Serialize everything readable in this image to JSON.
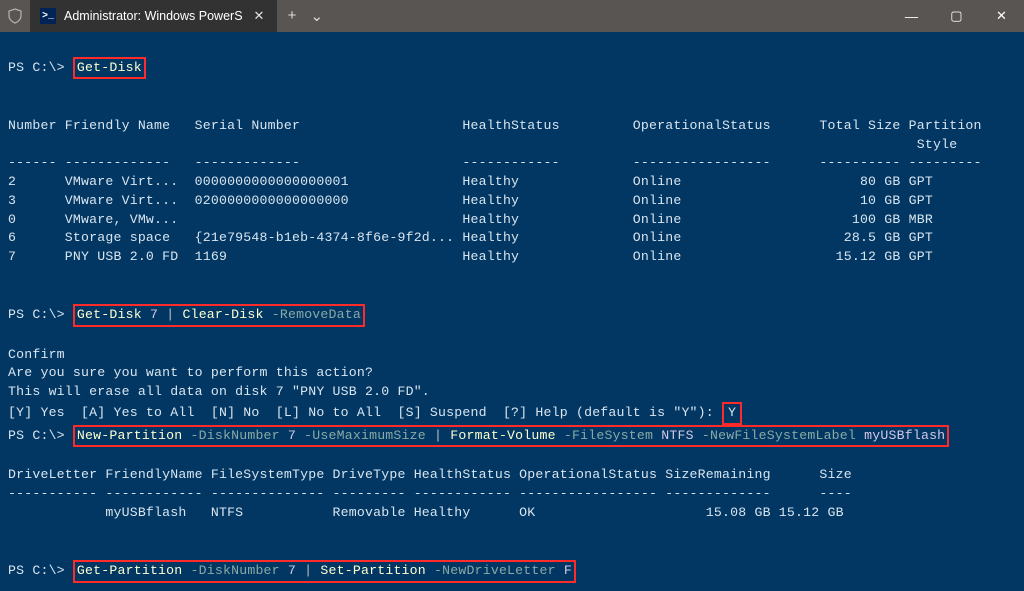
{
  "window": {
    "tab_title": "Administrator: Windows PowerS",
    "icon_glyph": ">_",
    "close_glyph": "✕",
    "new_tab_glyph": "+",
    "dropdown_glyph": "⌄",
    "min_glyph": "—",
    "max_glyph": "▢",
    "wclose_glyph": "✕"
  },
  "prompt": "PS C:\\>",
  "cmd1": "Get-Disk",
  "disk_header": "Number Friendly Name   Serial Number                    HealthStatus         OperationalStatus      Total Size Partition\n                                                                                                                Style",
  "disk_sep": "------ -------------   -------------                    ------------         -----------------      ---------- ---------",
  "disk_rows": [
    "2      VMware Virt...  0000000000000000001              Healthy              Online                      80 GB GPT",
    "3      VMware Virt...  0200000000000000000              Healthy              Online                      10 GB GPT",
    "0      VMware, VMw...                                   Healthy              Online                     100 GB MBR",
    "6      Storage space   {21e79548-b1eb-4374-8f6e-9f2d... Healthy              Online                    28.5 GB GPT",
    "7      PNY USB 2.0 FD  1169                             Healthy              Online                   15.12 GB GPT"
  ],
  "cmd2": {
    "a": "Get-Disk",
    "n": "7",
    "pipe": "|",
    "b": "Clear-Disk",
    "p": "-RemoveData"
  },
  "confirm_title": "Confirm",
  "confirm_l1": "Are you sure you want to perform this action?",
  "confirm_l2": "This will erase all data on disk 7 \"PNY USB 2.0 FD\".",
  "confirm_opts": "[Y] Yes  [A] Yes to All  [N] No  [L] No to All  [S] Suspend  [?] Help (default is \"Y\"):",
  "confirm_ans": "Y",
  "cmd3": {
    "a": "New-Partition",
    "p1": "-DiskNumber",
    "n1": "7",
    "p2": "-UseMaximumSize",
    "pipe": "|",
    "b": "Format-Volume",
    "p3": "-FileSystem",
    "v3": "NTFS",
    "p4": "-NewFileSystemLabel",
    "v4": "myUSBflash"
  },
  "vol_header": "DriveLetter FriendlyName FileSystemType DriveType HealthStatus OperationalStatus SizeRemaining      Size",
  "vol_sep": "----------- ------------ -------------- --------- ------------ ----------------- -------------      ----",
  "vol_row": "            myUSBflash   NTFS           Removable Healthy      OK                     15.08 GB 15.12 GB",
  "cmd4": {
    "a": "Get-Partition",
    "p1": "-DiskNumber",
    "n1": "7",
    "pipe": "|",
    "b": "Set-Partition",
    "p2": "-NewDriveLetter",
    "v2": "F"
  }
}
